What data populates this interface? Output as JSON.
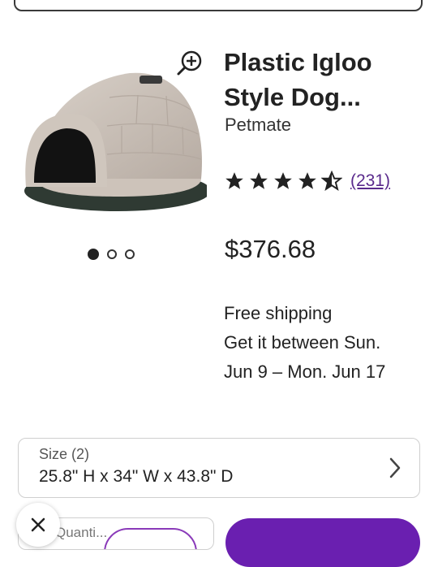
{
  "product": {
    "title": "Plastic Igloo Style Dog...",
    "brand": "Petmate",
    "rating": 4.5,
    "review_count": "(231)",
    "price": "$376.68",
    "image_count": 3,
    "active_image": 1,
    "image_icon": "igloo-dog-house-photo"
  },
  "shipping": {
    "line1": "Free shipping",
    "line2": "Get it between Sun.",
    "line3": "Jun 9 – Mon. Jun 17"
  },
  "size": {
    "label": "Size (2)",
    "value": "25.8\" H x 34\" W x 43.8\" D"
  },
  "quantity": {
    "label": "Quanti..."
  },
  "icons": {
    "zoom": "zoom-in-icon",
    "star": "star-icon",
    "chevron": "chevron-right-icon",
    "close": "close-icon"
  },
  "colors": {
    "accent": "#6a1fb0",
    "link": "#5a2a8c",
    "text": "#222222"
  }
}
